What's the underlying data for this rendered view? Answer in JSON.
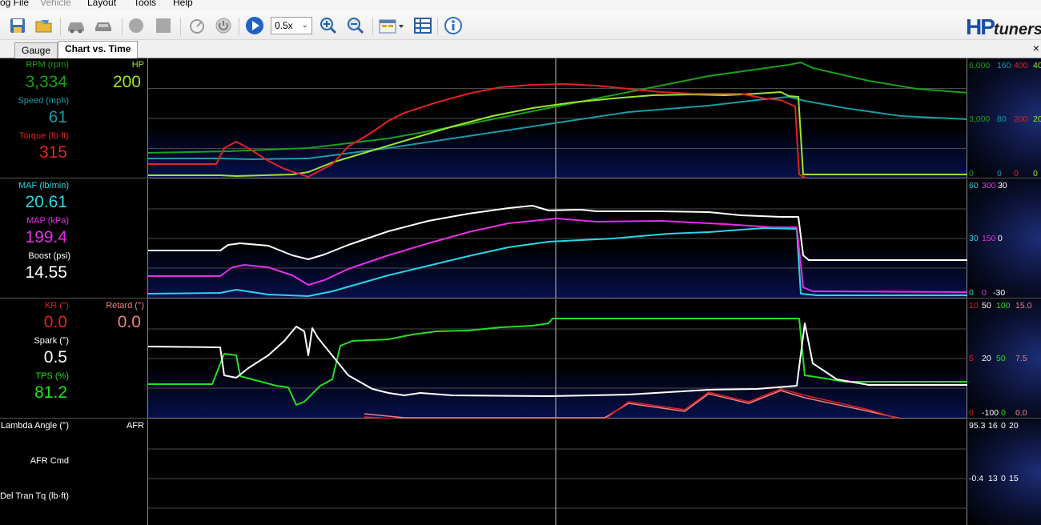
{
  "menu": {
    "log_file": "og File",
    "vehicle": "Vehicle",
    "layout": "Layout",
    "tools": "Tools",
    "help": "Help"
  },
  "toolbar": {
    "zoom_value": "0.5x",
    "brand_hp": "HP",
    "brand_tuners": "tuners"
  },
  "tabs": [
    {
      "label": "Gauge"
    },
    {
      "label": "Chart vs. Time"
    }
  ],
  "close_label": "×",
  "panels": {
    "p1": {
      "rpm": {
        "label": "RPM (rpm)",
        "value": "3,334",
        "color": "#1aa01a"
      },
      "hp": {
        "label": "HP",
        "value": "200",
        "color": "#9ae62d"
      },
      "speed": {
        "label": "Speed (mph)",
        "value": "61",
        "color": "#1a9aa8"
      },
      "torque": {
        "label": "Torque (lb·ft)",
        "value": "315",
        "color": "#e62020"
      },
      "scale": {
        "r1": [
          "6,000",
          "160",
          "400",
          "40"
        ],
        "r2": [
          "3,000",
          "80",
          "200",
          "20"
        ],
        "r3": [
          "0",
          "0",
          "0",
          "0"
        ]
      }
    },
    "p2": {
      "maf": {
        "label": "MAF (lb/min)",
        "value": "20.61",
        "color": "#2ad6e6"
      },
      "map": {
        "label": "MAP (kPa)",
        "value": "199.4",
        "color": "#e62ee6"
      },
      "boost": {
        "label": "Boost (psi)",
        "value": "14.55",
        "color": "#ffffff"
      },
      "scale": {
        "r1": [
          "60",
          "300",
          "30"
        ],
        "r2": [
          "30",
          "150",
          "0"
        ],
        "r3": [
          "0",
          "0",
          "-30"
        ]
      }
    },
    "p3": {
      "kr": {
        "label": "KR (°)",
        "value": "0.0",
        "color": "#e61e1e"
      },
      "retard": {
        "label": "Retard (°)",
        "value": "0.0",
        "color": "#f08080"
      },
      "spark": {
        "label": "Spark (°)",
        "value": "0.5",
        "color": "#ffffff"
      },
      "tps": {
        "label": "TPS (%)",
        "value": "81.2",
        "color": "#22e022"
      },
      "scale": {
        "r1": [
          "10",
          "50",
          "100",
          "15.0"
        ],
        "r2": [
          "5",
          "20",
          "50",
          "7.5"
        ],
        "r3": [
          "0",
          "-100",
          "0",
          "0.0"
        ]
      }
    },
    "p4": {
      "lambda": {
        "label": "Lambda Angle (°)"
      },
      "afr": {
        "label": "AFR"
      },
      "afr_cmd": {
        "label": "AFR Cmd"
      },
      "del_tq": {
        "label": "Del Tran Tq (lb·ft)"
      },
      "scale": {
        "r1": [
          "95.3",
          "16",
          "0",
          "20"
        ],
        "r2": [
          "-0.4",
          "13",
          "0",
          "15"
        ]
      }
    }
  },
  "chart_data": {
    "type": "line",
    "x_range": [
      0,
      1024
    ],
    "p1": {
      "rpm": [
        [
          0,
          118
        ],
        [
          100,
          116
        ],
        [
          200,
          112
        ],
        [
          300,
          100
        ],
        [
          400,
          82
        ],
        [
          500,
          62
        ],
        [
          600,
          42
        ],
        [
          700,
          22
        ],
        [
          800,
          8
        ],
        [
          815,
          5
        ],
        [
          830,
          12
        ],
        [
          900,
          28
        ],
        [
          960,
          38
        ],
        [
          1024,
          43
        ]
      ],
      "hp": [
        [
          0,
          146
        ],
        [
          90,
          146
        ],
        [
          110,
          147
        ],
        [
          180,
          145
        ],
        [
          200,
          142
        ],
        [
          230,
          130
        ],
        [
          280,
          115
        ],
        [
          330,
          100
        ],
        [
          380,
          85
        ],
        [
          430,
          72
        ],
        [
          480,
          62
        ],
        [
          530,
          55
        ],
        [
          580,
          50
        ],
        [
          630,
          46
        ],
        [
          680,
          45
        ],
        [
          720,
          46
        ],
        [
          760,
          44
        ],
        [
          790,
          42
        ],
        [
          800,
          47
        ],
        [
          812,
          48
        ],
        [
          818,
          145
        ],
        [
          1024,
          145
        ]
      ],
      "speed": [
        [
          0,
          125
        ],
        [
          90,
          125
        ],
        [
          130,
          126
        ],
        [
          200,
          125
        ],
        [
          300,
          112
        ],
        [
          400,
          97
        ],
        [
          500,
          82
        ],
        [
          600,
          67
        ],
        [
          700,
          59
        ],
        [
          760,
          52
        ],
        [
          800,
          48
        ],
        [
          820,
          53
        ],
        [
          870,
          62
        ],
        [
          940,
          72
        ],
        [
          1024,
          76
        ]
      ],
      "torque": [
        [
          0,
          132
        ],
        [
          85,
          132
        ],
        [
          95,
          112
        ],
        [
          110,
          104
        ],
        [
          125,
          112
        ],
        [
          150,
          128
        ],
        [
          170,
          138
        ],
        [
          200,
          148
        ],
        [
          230,
          132
        ],
        [
          250,
          110
        ],
        [
          280,
          92
        ],
        [
          300,
          78
        ],
        [
          320,
          68
        ],
        [
          360,
          55
        ],
        [
          400,
          44
        ],
        [
          440,
          36
        ],
        [
          480,
          33
        ],
        [
          520,
          32
        ],
        [
          560,
          34
        ],
        [
          600,
          38
        ],
        [
          640,
          42
        ],
        [
          680,
          44
        ],
        [
          700,
          44
        ],
        [
          740,
          44
        ],
        [
          770,
          50
        ],
        [
          790,
          52
        ],
        [
          808,
          60
        ],
        [
          813,
          145
        ],
        [
          822,
          150
        ]
      ]
    },
    "p2": {
      "boost": [
        [
          0,
          89
        ],
        [
          90,
          89
        ],
        [
          100,
          82
        ],
        [
          115,
          80
        ],
        [
          150,
          83
        ],
        [
          180,
          95
        ],
        [
          200,
          100
        ],
        [
          220,
          94
        ],
        [
          250,
          82
        ],
        [
          300,
          65
        ],
        [
          350,
          52
        ],
        [
          400,
          43
        ],
        [
          450,
          36
        ],
        [
          480,
          33
        ],
        [
          500,
          39
        ],
        [
          540,
          38
        ],
        [
          560,
          40
        ],
        [
          640,
          40
        ],
        [
          700,
          41
        ],
        [
          740,
          45
        ],
        [
          790,
          47
        ],
        [
          812,
          47
        ],
        [
          818,
          95
        ],
        [
          825,
          101
        ],
        [
          1024,
          101
        ]
      ],
      "map": [
        [
          0,
          121
        ],
        [
          90,
          121
        ],
        [
          105,
          110
        ],
        [
          120,
          107
        ],
        [
          150,
          110
        ],
        [
          180,
          120
        ],
        [
          200,
          132
        ],
        [
          220,
          126
        ],
        [
          250,
          112
        ],
        [
          300,
          95
        ],
        [
          350,
          80
        ],
        [
          400,
          66
        ],
        [
          450,
          55
        ],
        [
          510,
          49
        ],
        [
          560,
          53
        ],
        [
          640,
          52
        ],
        [
          720,
          56
        ],
        [
          780,
          60
        ],
        [
          810,
          60
        ],
        [
          818,
          135
        ],
        [
          830,
          140
        ],
        [
          1024,
          141
        ]
      ],
      "maf": [
        [
          0,
          143
        ],
        [
          90,
          142
        ],
        [
          110,
          138
        ],
        [
          150,
          144
        ],
        [
          200,
          146
        ],
        [
          230,
          140
        ],
        [
          300,
          120
        ],
        [
          350,
          108
        ],
        [
          400,
          96
        ],
        [
          450,
          85
        ],
        [
          500,
          78
        ],
        [
          580,
          74
        ],
        [
          650,
          68
        ],
        [
          700,
          66
        ],
        [
          740,
          63
        ],
        [
          770,
          61
        ],
        [
          810,
          62
        ],
        [
          815,
          143
        ],
        [
          835,
          145
        ],
        [
          1024,
          145
        ]
      ]
    },
    "p3": {
      "tps": [
        [
          0,
          106
        ],
        [
          80,
          106
        ],
        [
          95,
          68
        ],
        [
          110,
          70
        ],
        [
          115,
          96
        ],
        [
          160,
          108
        ],
        [
          175,
          110
        ],
        [
          185,
          132
        ],
        [
          195,
          128
        ],
        [
          215,
          108
        ],
        [
          230,
          100
        ],
        [
          240,
          58
        ],
        [
          255,
          52
        ],
        [
          300,
          50
        ],
        [
          330,
          44
        ],
        [
          360,
          40
        ],
        [
          400,
          39
        ],
        [
          440,
          35
        ],
        [
          480,
          33
        ],
        [
          500,
          30
        ],
        [
          505,
          24
        ],
        [
          800,
          24
        ],
        [
          813,
          24
        ],
        [
          820,
          95
        ],
        [
          840,
          98
        ],
        [
          870,
          103
        ],
        [
          1024,
          103
        ]
      ],
      "spark": [
        [
          0,
          59
        ],
        [
          90,
          60
        ],
        [
          95,
          95
        ],
        [
          110,
          98
        ],
        [
          125,
          86
        ],
        [
          150,
          70
        ],
        [
          170,
          52
        ],
        [
          185,
          34
        ],
        [
          195,
          40
        ],
        [
          200,
          70
        ],
        [
          205,
          36
        ],
        [
          212,
          48
        ],
        [
          220,
          58
        ],
        [
          250,
          95
        ],
        [
          280,
          112
        ],
        [
          300,
          117
        ],
        [
          320,
          120
        ],
        [
          340,
          117
        ],
        [
          380,
          120
        ],
        [
          500,
          121
        ],
        [
          600,
          119
        ],
        [
          700,
          113
        ],
        [
          760,
          112
        ],
        [
          810,
          108
        ],
        [
          820,
          30
        ],
        [
          830,
          80
        ],
        [
          860,
          100
        ],
        [
          900,
          107
        ],
        [
          1024,
          107
        ]
      ],
      "kr": [
        [
          270,
          147
        ],
        [
          320,
          150
        ],
        [
          570,
          150
        ],
        [
          600,
          128
        ],
        [
          670,
          138
        ],
        [
          700,
          116
        ],
        [
          750,
          128
        ],
        [
          790,
          112
        ],
        [
          820,
          120
        ],
        [
          900,
          138
        ],
        [
          940,
          150
        ]
      ],
      "retard": [
        [
          270,
          143
        ],
        [
          320,
          148
        ],
        [
          570,
          148
        ],
        [
          600,
          130
        ],
        [
          670,
          140
        ],
        [
          700,
          118
        ],
        [
          750,
          130
        ],
        [
          790,
          114
        ],
        [
          820,
          123
        ],
        [
          900,
          140
        ],
        [
          940,
          149
        ]
      ]
    }
  }
}
